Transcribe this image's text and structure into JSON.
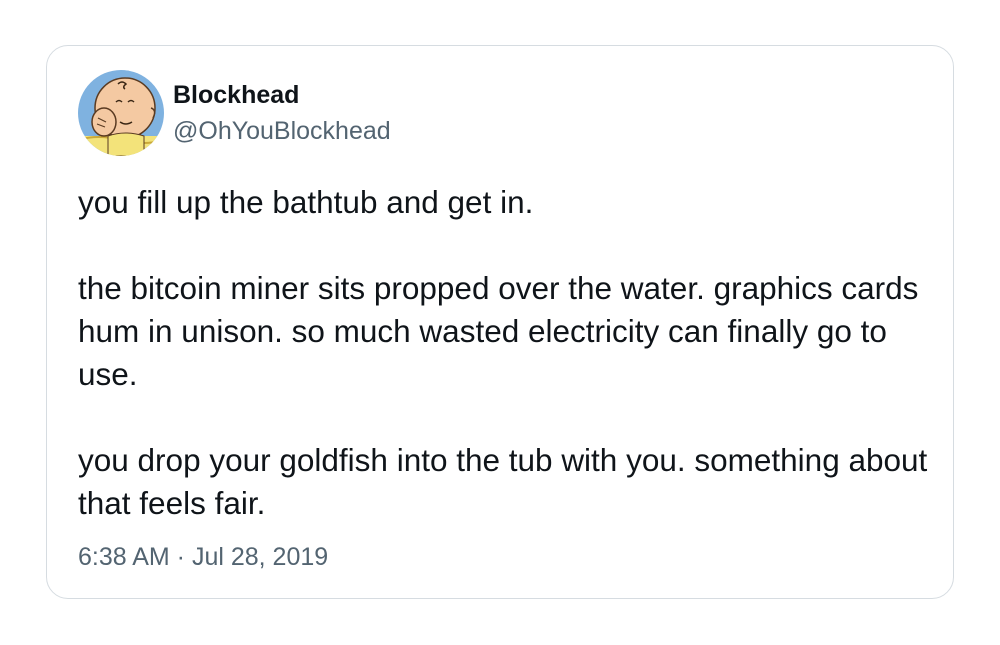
{
  "author": {
    "display_name": "Blockhead",
    "handle": "@OhYouBlockhead",
    "avatar_icon": "charlie-brown-avatar-icon"
  },
  "tweet": {
    "paragraphs": [
      "you fill up the bathtub and get in.",
      "the bitcoin miner sits propped over the water. graphics cards hum in unison. so much wasted electricity can finally go to use.",
      "you drop your goldfish into the tub with you. something about that feels fair."
    ],
    "timestamp": "6:38 AM · Jul 28, 2019"
  },
  "colors": {
    "text_primary": "#0f1419",
    "text_secondary": "#536471",
    "card_border": "#d6dce1",
    "avatar_background": "#7fb2e0"
  }
}
